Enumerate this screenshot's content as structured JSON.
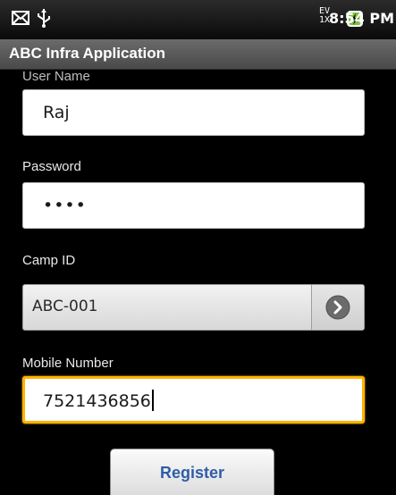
{
  "status_bar": {
    "network_top": "EV",
    "network_bottom": "1X",
    "time": "8:54 PM",
    "icons": [
      "mail-icon",
      "usb-icon",
      "network-signal-icon",
      "battery-charging-icon"
    ]
  },
  "app": {
    "title": "ABC Infra Application"
  },
  "form": {
    "user_name": {
      "label": "User Name",
      "value": "Raj"
    },
    "password": {
      "label": "Password",
      "value": "••••"
    },
    "camp_id": {
      "label": "Camp ID",
      "value": "ABC-001"
    },
    "mobile_number": {
      "label": "Mobile Number",
      "value": "7521436856"
    },
    "register_label": "Register"
  },
  "colors": {
    "title_bar": "#5a5a5a",
    "focus_border": "#ffb400",
    "register_text": "#2e5ea8",
    "background": "#000000"
  }
}
